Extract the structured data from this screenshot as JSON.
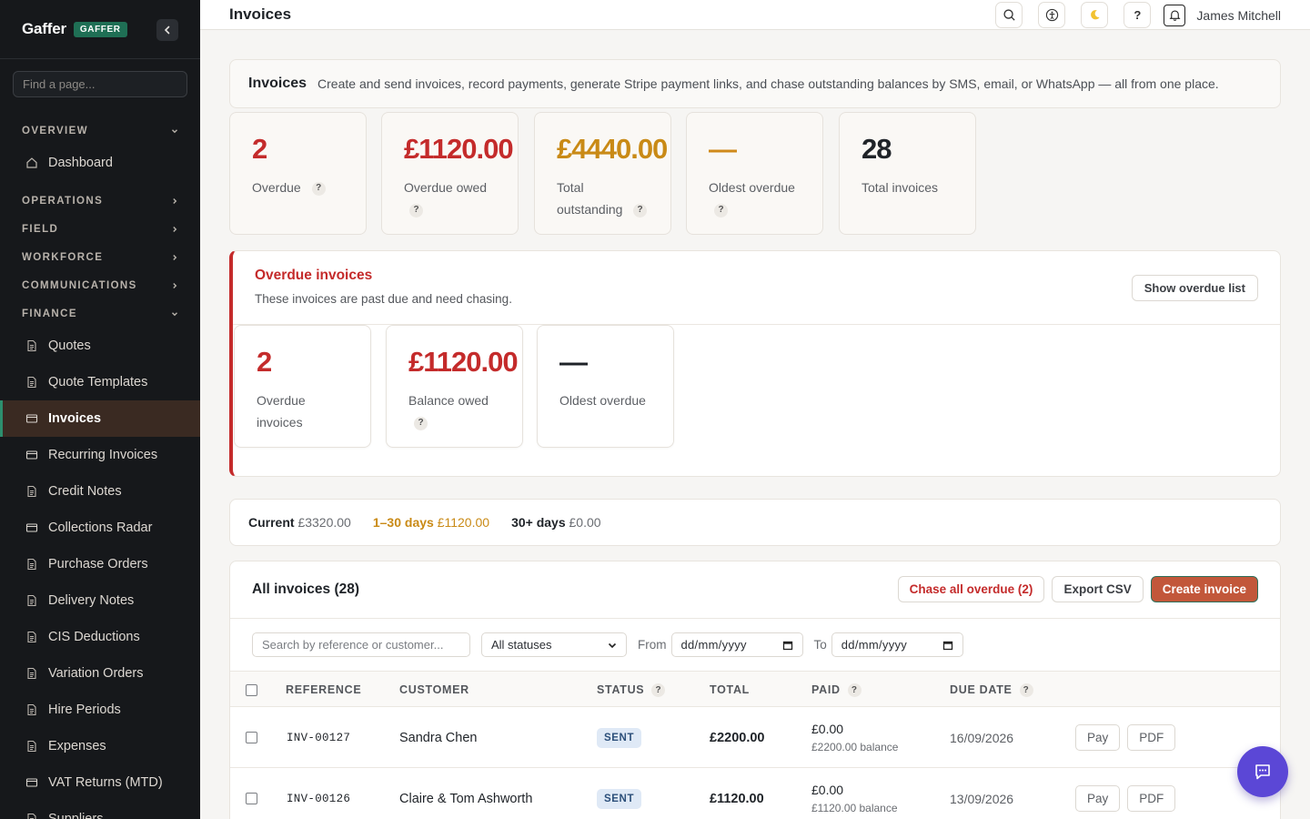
{
  "app": {
    "brand": "Gaffer",
    "badge": "GAFFER"
  },
  "sidebar": {
    "search_placeholder": "Find a page...",
    "sections": {
      "overview": "OVERVIEW",
      "operations": "OPERATIONS",
      "field": "FIELD",
      "workforce": "WORKFORCE",
      "communications": "COMMUNICATIONS",
      "finance": "FINANCE"
    },
    "dashboard": "Dashboard",
    "finance_items": [
      "Quotes",
      "Quote Templates",
      "Invoices",
      "Recurring Invoices",
      "Credit Notes",
      "Collections Radar",
      "Purchase Orders",
      "Delivery Notes",
      "CIS Deductions",
      "Variation Orders",
      "Hire Periods",
      "Expenses",
      "VAT Returns (MTD)",
      "Suppliers"
    ],
    "active_item": "Invoices"
  },
  "topbar": {
    "title": "Invoices",
    "help_label": "?",
    "user_name": "James Mitchell"
  },
  "intro": {
    "title": "Invoices",
    "text": "Create and send invoices, record payments, generate Stripe payment links, and chase outstanding balances by SMS, email, or WhatsApp — all from one place."
  },
  "stats": [
    {
      "value": "2",
      "label": "Overdue",
      "color": "#c42b2b"
    },
    {
      "value": "£1120.00",
      "label": "Overdue owed",
      "color": "#c42b2b"
    },
    {
      "value": "£4440.00",
      "label": "Total outstanding",
      "color": "#c98a16"
    },
    {
      "value": "—",
      "label": "Oldest overdue",
      "color": "#d08a1a"
    },
    {
      "value": "28",
      "label": "Total invoices",
      "color": "#1f2328"
    }
  ],
  "overdue": {
    "title": "Overdue invoices",
    "subtitle": "These invoices are past due and need chasing.",
    "button": "Show overdue list",
    "stats": [
      {
        "value": "2",
        "label": "Overdue invoices"
      },
      {
        "value": "£1120.00",
        "label": "Balance owed"
      },
      {
        "value": "—",
        "label": "Oldest overdue"
      }
    ]
  },
  "aging": {
    "current_label": "Current",
    "current_value": "£3320.00",
    "b1_label": "1–30 days",
    "b1_value": "£1120.00",
    "b2_label": "30+ days",
    "b2_value": "£0.00"
  },
  "invoices": {
    "title": "All invoices (28)",
    "chase_button": "Chase all overdue (2)",
    "export_button": "Export CSV",
    "create_button": "Create invoice",
    "search_placeholder": "Search by reference or customer...",
    "status_filter": "All statuses",
    "from_label": "From",
    "to_label": "To",
    "date_placeholder": "dd/mm/yyyy",
    "columns": [
      "REFERENCE",
      "CUSTOMER",
      "STATUS",
      "TOTAL",
      "PAID",
      "DUE DATE"
    ],
    "rows": [
      {
        "ref": "INV-00127",
        "customer": "Sandra Chen",
        "status": "SENT",
        "total": "£2200.00",
        "paid": "£0.00",
        "balance": "£2200.00 balance",
        "due": "16/09/2026"
      },
      {
        "ref": "INV-00126",
        "customer": "Claire & Tom Ashworth",
        "status": "SENT",
        "total": "£1120.00",
        "paid": "£0.00",
        "balance": "£1120.00 balance",
        "due": "13/09/2026"
      }
    ],
    "pay_label": "Pay",
    "pdf_label": "PDF"
  }
}
